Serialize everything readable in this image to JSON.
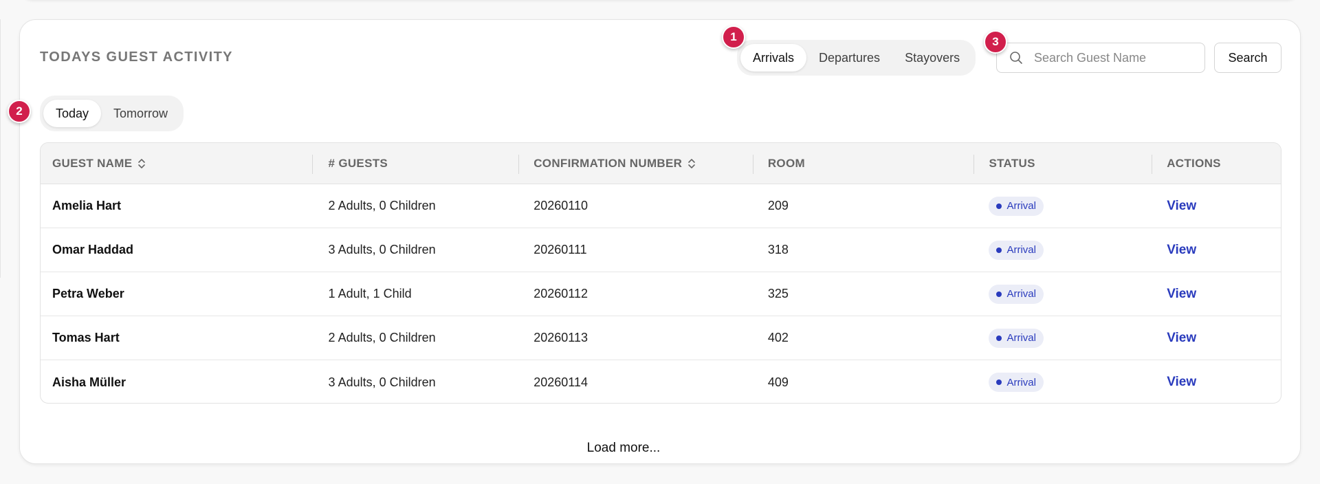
{
  "section": {
    "title": "TODAYS GUEST ACTIVITY"
  },
  "activity_tabs": [
    {
      "label": "Arrivals",
      "active": true
    },
    {
      "label": "Departures",
      "active": false
    },
    {
      "label": "Stayovers",
      "active": false
    }
  ],
  "day_tabs": [
    {
      "label": "Today",
      "active": true
    },
    {
      "label": "Tomorrow",
      "active": false
    }
  ],
  "badges": [
    "1",
    "2",
    "3"
  ],
  "search": {
    "placeholder": "Search Guest Name",
    "value": "",
    "button_label": "Search",
    "icon": "search-icon"
  },
  "table": {
    "columns": [
      "GUEST NAME",
      "# GUESTS",
      "CONFIRMATION NUMBER",
      "ROOM",
      "STATUS",
      "ACTIONS"
    ],
    "rows": [
      {
        "name": "Amelia Hart",
        "guests": "2 Adults, 0 Children",
        "confirmation": "20260110",
        "room": "209",
        "status": "Arrival",
        "action": "View"
      },
      {
        "name": "Omar Haddad",
        "guests": "3 Adults, 0 Children",
        "confirmation": "20260111",
        "room": "318",
        "status": "Arrival",
        "action": "View"
      },
      {
        "name": "Petra Weber",
        "guests": "1 Adult, 1 Child",
        "confirmation": "20260112",
        "room": "325",
        "status": "Arrival",
        "action": "View"
      },
      {
        "name": "Tomas Hart",
        "guests": "2 Adults, 0 Children",
        "confirmation": "20260113",
        "room": "402",
        "status": "Arrival",
        "action": "View"
      },
      {
        "name": "Aisha Müller",
        "guests": "3 Adults, 0 Children",
        "confirmation": "20260114",
        "room": "409",
        "status": "Arrival",
        "action": "View"
      }
    ]
  },
  "load_more_label": "Load more...",
  "colors": {
    "badge": "#d11f4c",
    "status_text": "#2a3bbd",
    "status_bg": "#ebedf7",
    "link": "#2a3bbd"
  }
}
